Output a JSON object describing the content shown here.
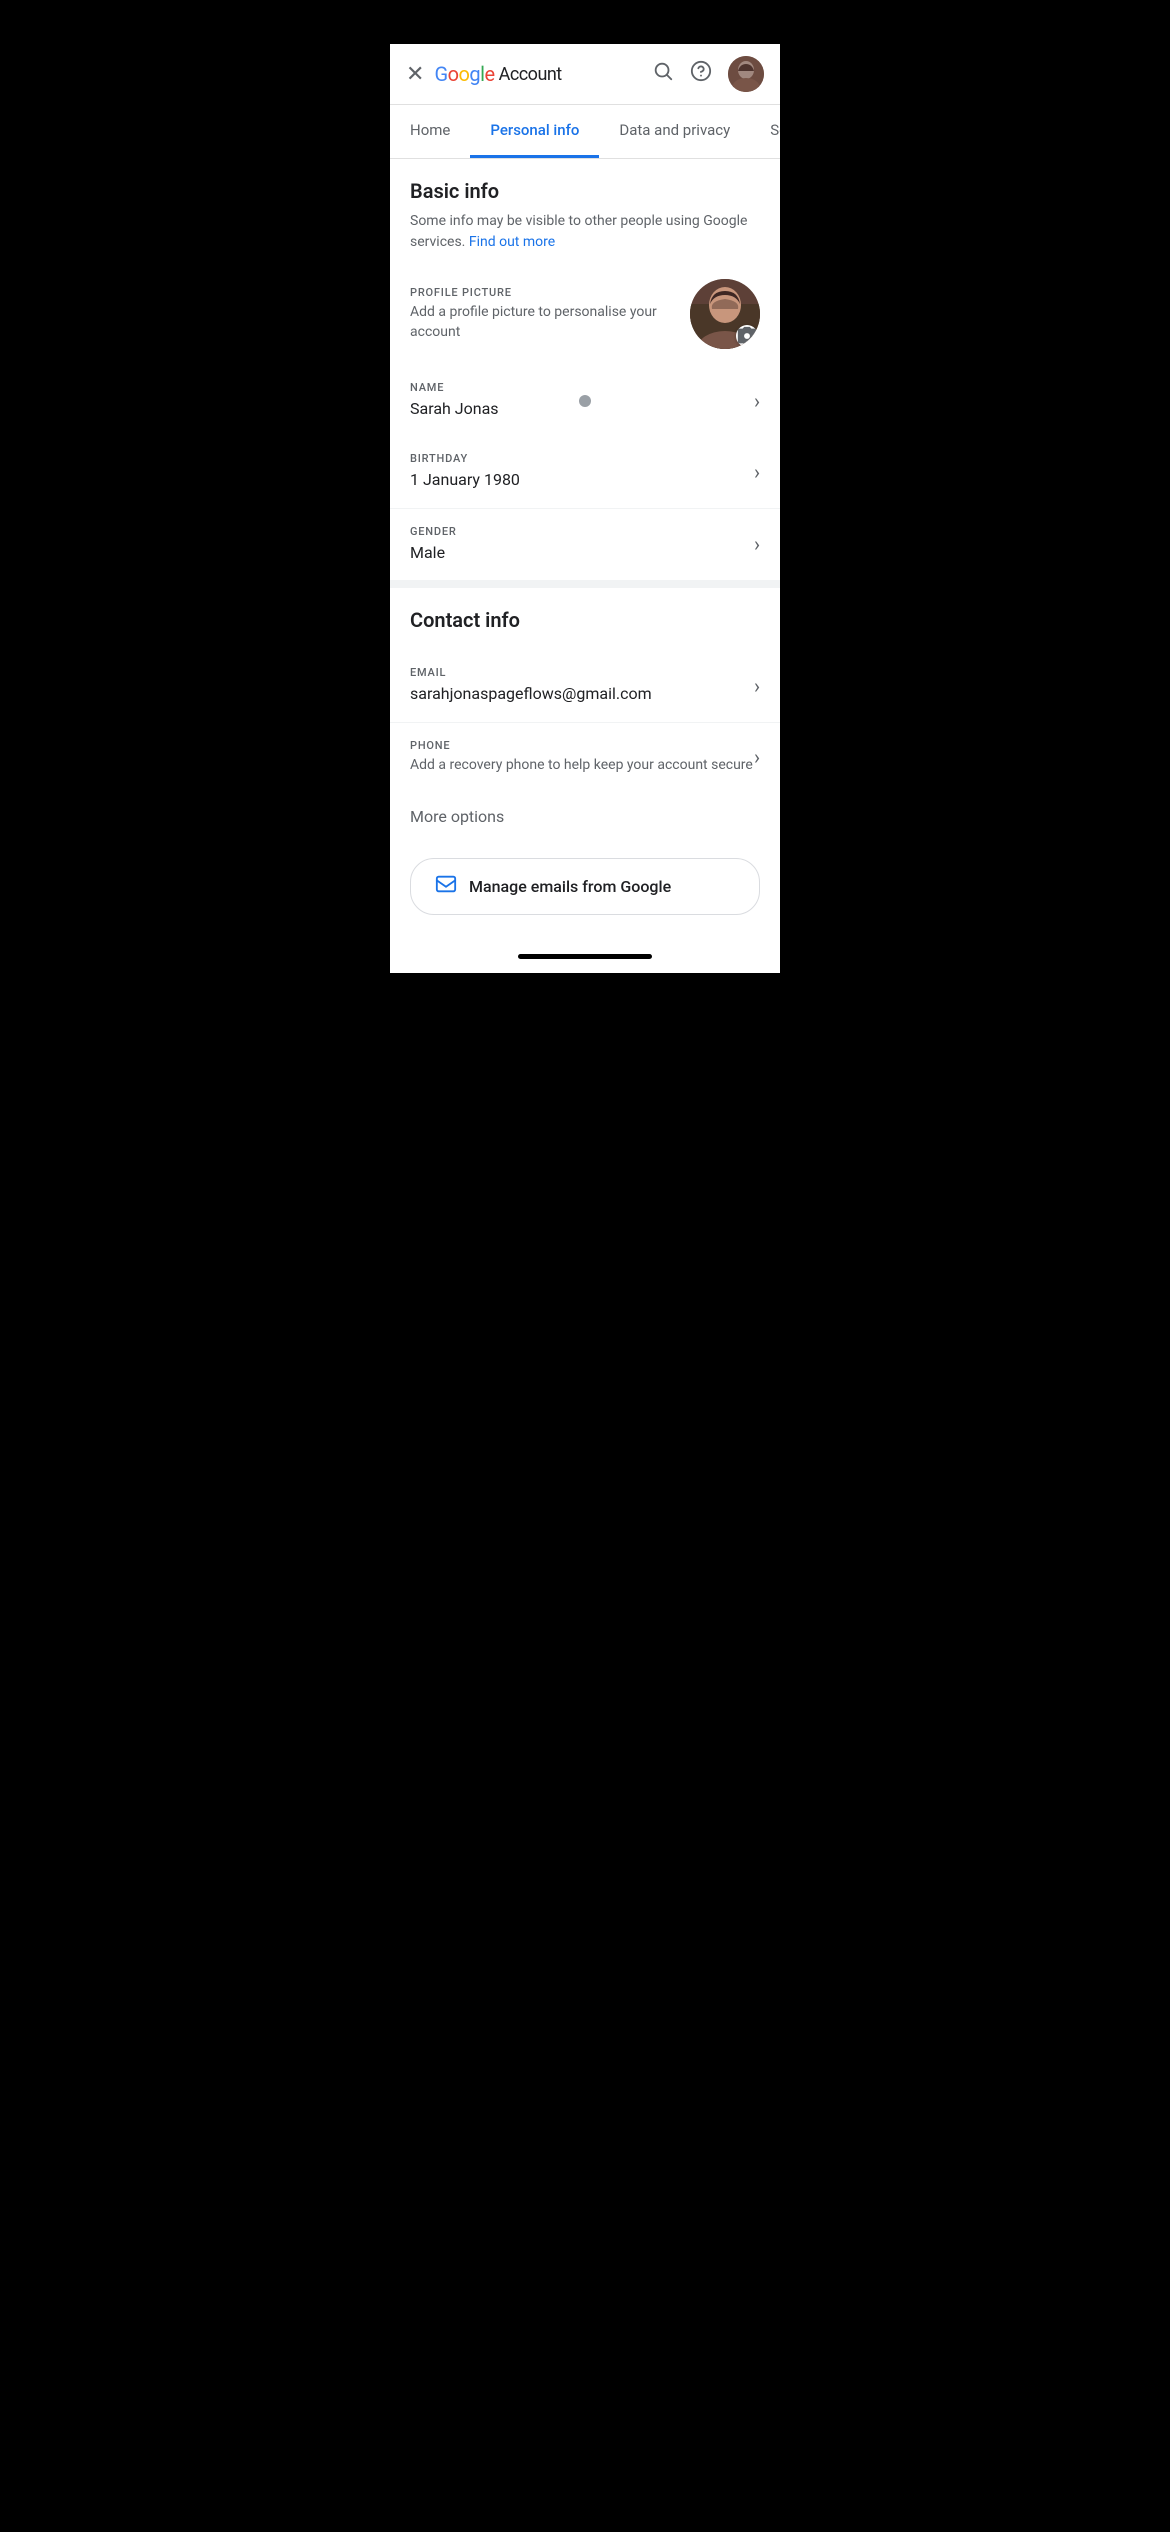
{
  "statusBar": {
    "background": "#000"
  },
  "header": {
    "closeIcon": "✕",
    "googleText": "Google",
    "accountText": " Account",
    "searchIcon": "🔍",
    "helpIcon": "?",
    "avatarAlt": "User avatar"
  },
  "nav": {
    "tabs": [
      {
        "id": "home",
        "label": "Home",
        "active": false
      },
      {
        "id": "personal-info",
        "label": "Personal info",
        "active": true
      },
      {
        "id": "data-privacy",
        "label": "Data and privacy",
        "active": false
      },
      {
        "id": "security",
        "label": "Sec",
        "active": false
      }
    ]
  },
  "basicInfo": {
    "title": "Basic info",
    "subtitle": "Some info may be visible to other people using Google services.",
    "findOutMore": "Find out more",
    "profilePicture": {
      "label": "PROFILE PICTURE",
      "description": "Add a profile picture to personalise your account"
    },
    "name": {
      "label": "NAME",
      "value": "Sarah Jonas"
    },
    "birthday": {
      "label": "BIRTHDAY",
      "value": "1 January 1980"
    },
    "gender": {
      "label": "GENDER",
      "value": "Male"
    }
  },
  "contactInfo": {
    "title": "Contact info",
    "email": {
      "label": "EMAIL",
      "value": "sarahjonaspageflows@gmail.com"
    },
    "phone": {
      "label": "PHONE",
      "description": "Add a recovery phone to help keep your account secure"
    },
    "moreOptions": "More options",
    "manageEmailsButton": "Manage emails from Google"
  }
}
